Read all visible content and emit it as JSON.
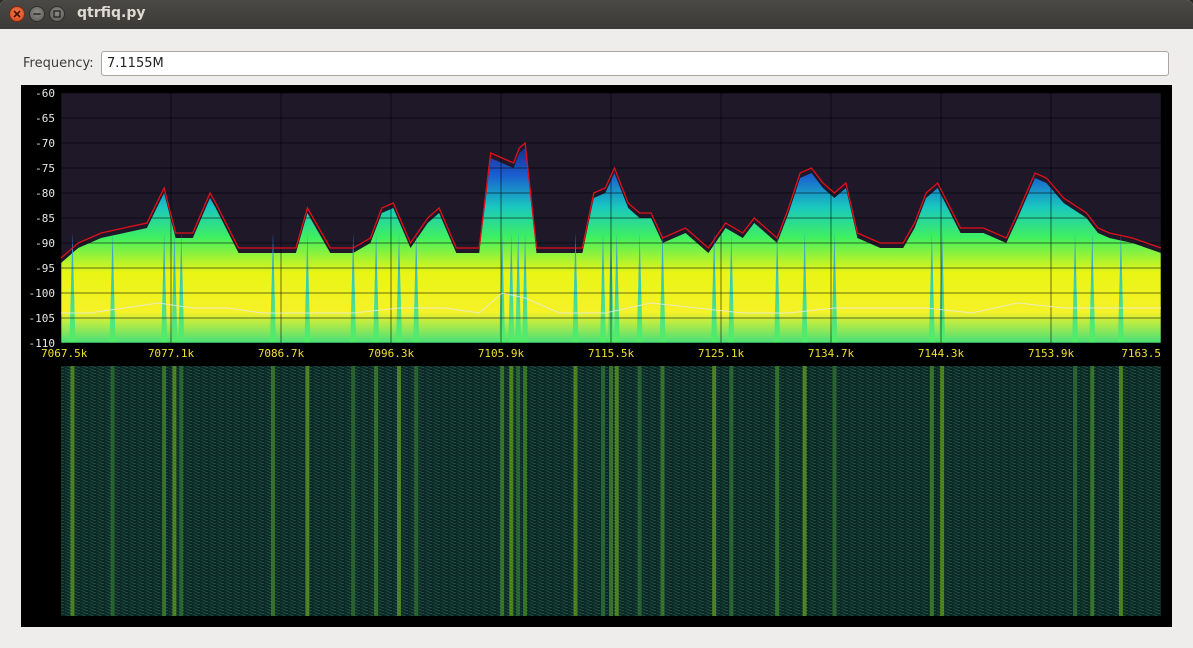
{
  "window": {
    "title": "qtrfiq.py"
  },
  "frequency": {
    "label": "Frequency:",
    "value": "7.1155M"
  },
  "colors": {
    "spectrum_peak": "#e0101a",
    "spectrum_avg": "#e8e8e8",
    "axis_label": "#f0e030"
  },
  "chart_data": [
    {
      "type": "area",
      "ylim": [
        -110,
        -60
      ],
      "y_ticks": [
        "-60",
        "-65",
        "-70",
        "-75",
        "-80",
        "-85",
        "-90",
        "-95",
        "-100",
        "-105",
        "-110"
      ],
      "x_tick_labels": [
        "7067.5k",
        "7077.1k",
        "7086.7k",
        "7096.3k",
        "7105.9k",
        "7115.5k",
        "7125.1k",
        "7134.7k",
        "7144.3k",
        "7153.9k",
        "7163.5"
      ],
      "xlim": [
        7067.5,
        7163.5
      ],
      "grid": true,
      "series": [
        {
          "x": [
            7067.5,
            7069,
            7071,
            7073,
            7075,
            7076.5,
            7077.5,
            7079,
            7080.5,
            7081,
            7083,
            7085,
            7087,
            7088,
            7089,
            7091,
            7093,
            7094.5,
            7095.5,
            7096.5,
            7098,
            7099.5,
            7100.5,
            7102,
            7104,
            7105,
            7106,
            7107,
            7107.5,
            7108,
            7109,
            7110,
            7111,
            7113,
            7114,
            7115,
            7115.8,
            7117,
            7118,
            7119,
            7120,
            7122,
            7124,
            7125.5,
            7127,
            7128,
            7130,
            7131,
            7132,
            7133,
            7134,
            7135,
            7136,
            7137,
            7139,
            7141,
            7142,
            7143,
            7144,
            7146,
            7148,
            7150,
            7151,
            7152.5,
            7153.5,
            7155,
            7157,
            7158,
            7159,
            7161,
            7163.5
          ],
          "values": [
            -93,
            -90,
            -88,
            -87,
            -86,
            -79,
            -88,
            -88,
            -80,
            -82,
            -91,
            -91,
            -91,
            -91,
            -83,
            -91,
            -91,
            -89,
            -83,
            -82,
            -90,
            -85,
            -83,
            -91,
            -91,
            -72,
            -73,
            -74,
            -71,
            -70,
            -91,
            -91,
            -91,
            -91,
            -80,
            -79,
            -75,
            -82,
            -84,
            -84,
            -89,
            -87,
            -91,
            -86,
            -88,
            -85,
            -89,
            -83,
            -76,
            -75,
            -78,
            -80,
            -78,
            -88,
            -90,
            -90,
            -86,
            -80,
            -78,
            -87,
            -87,
            -89,
            -84,
            -76,
            -77,
            -81,
            -84,
            -87,
            -88,
            -89,
            -91
          ]
        },
        {
          "x": [
            7067.5,
            7070,
            7073,
            7076,
            7079,
            7082,
            7085,
            7089,
            7093,
            7097,
            7101,
            7104,
            7106,
            7108,
            7111,
            7115,
            7119,
            7123,
            7127,
            7131,
            7135,
            7139,
            7143,
            7147,
            7151,
            7155,
            7159,
            7163.5
          ],
          "values": [
            -104,
            -104,
            -103,
            -102,
            -103,
            -103,
            -104,
            -104,
            -104,
            -103,
            -103,
            -104,
            -100,
            -101,
            -104,
            -104,
            -102,
            -103,
            -104,
            -104,
            -103,
            -103,
            -103,
            -104,
            -102,
            -103,
            -103,
            -103
          ]
        }
      ]
    },
    {
      "type": "heatmap",
      "xlim": [
        7067.5,
        7163.5
      ],
      "bright_columns": [
        7068.5,
        7072,
        7076.5,
        7077.4,
        7078,
        7086,
        7089,
        7093,
        7095,
        7097,
        7098.5,
        7106,
        7106.8,
        7107.4,
        7108,
        7112.4,
        7114.8,
        7115.5,
        7116,
        7118,
        7120,
        7124.5,
        7126,
        7130,
        7132.4,
        7135,
        7143.5,
        7144.4,
        7156,
        7157.5,
        7160
      ]
    }
  ]
}
